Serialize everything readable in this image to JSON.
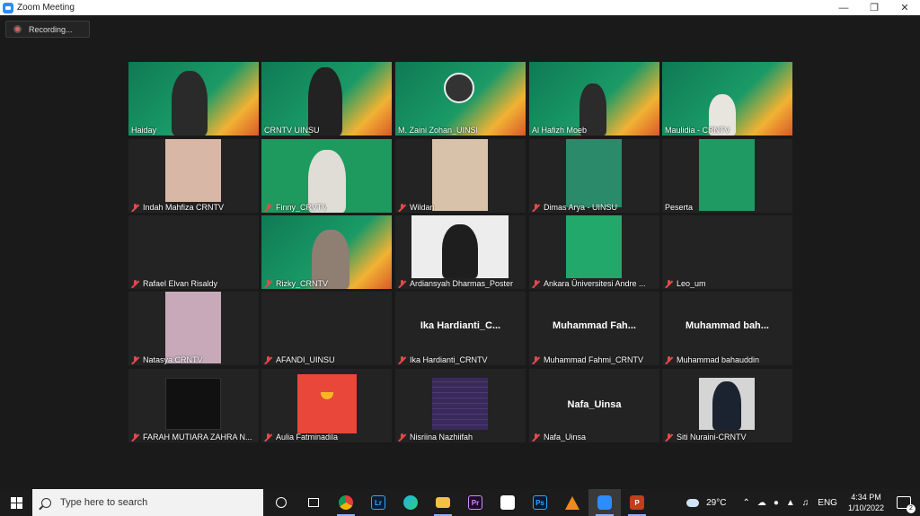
{
  "window": {
    "title": "Zoom Meeting"
  },
  "recording": {
    "label": "Recording..."
  },
  "participants": [
    "Haiday",
    "CRNTV UINSU",
    "M. Zaini Zohan_UINSI",
    "Al Hafizh Moeb",
    "Maulidia - CRNTV",
    "Indah Mahfiza CRNTV",
    "Finny_CRVTV",
    "Wildan",
    "Dimas Arya - UINSU",
    "Peserta",
    "Rafael Elvan Risaldy",
    "Rizky_CRNTV",
    "Ardiansyah Dharmas_Poster",
    "Ankara Üniversitesi Andre ...",
    "Leo_um",
    "Natasya CRNTV",
    "AFANDI_UINSU",
    "Ika Hardianti_CRNTV",
    "Muhammad Fahmi_CRNTV",
    "Muhammad bahauddin",
    "FARAH MUTIARA ZAHRA N...",
    "Aulia Fatminadila",
    "Nisriina Nazhiifah",
    "Nafa_Uinsa",
    "Siti Nuraini-CRNTV"
  ],
  "big_names": {
    "ika": "Ika Hardianti_C...",
    "fahmi": "Muhammad Fah...",
    "bahauddin": "Muhammad bah...",
    "nafa": "Nafa_Uinsa"
  },
  "taskbar": {
    "search_placeholder": "Type here to search",
    "weather": "29°C",
    "language": "ENG",
    "time": "4:34 PM",
    "date": "1/10/2022",
    "notifications": "2",
    "lr_label": "Lr",
    "pr_label": "Pr",
    "ps_label": "Ps",
    "pp_label": "P"
  }
}
